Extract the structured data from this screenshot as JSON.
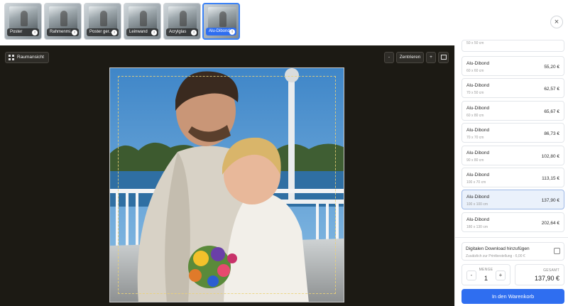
{
  "products": [
    {
      "label": "Poster",
      "active": false
    },
    {
      "label": "Rahmenmi…",
      "active": false
    },
    {
      "label": "Poster ger…",
      "active": false
    },
    {
      "label": "Leinwand",
      "active": false
    },
    {
      "label": "Acrylglas",
      "active": false
    },
    {
      "label": "Alu-Dibond",
      "active": true
    }
  ],
  "product_info_glyph": "i",
  "close_glyph": "×",
  "preview": {
    "room_view_label": "Raumansicht",
    "zoom_minus": "-",
    "zoom_center": "Zentrieren",
    "zoom_plus": "+"
  },
  "options": [
    {
      "name": "",
      "size": "50 x 50 cm",
      "price": "",
      "partial": true
    },
    {
      "name": "Alu-Dibond",
      "size": "60 x 60 cm",
      "price": "55,20 €"
    },
    {
      "name": "Alu-Dibond",
      "size": "70 x 50 cm",
      "price": "62,57 €"
    },
    {
      "name": "Alu-Dibond",
      "size": "60 x 80 cm",
      "price": "65,67 €"
    },
    {
      "name": "Alu-Dibond",
      "size": "70 x 70 cm",
      "price": "86,73 €"
    },
    {
      "name": "Alu-Dibond",
      "size": "90 x 80 cm",
      "price": "102,80 €"
    },
    {
      "name": "Alu-Dibond",
      "size": "100 x 70 cm",
      "price": "113,15 €"
    },
    {
      "name": "Alu-Dibond",
      "size": "100 x 100 cm",
      "price": "137,90 €",
      "selected": true
    },
    {
      "name": "Alu-Dibond",
      "size": "180 x 130 cm",
      "price": "202,64 €"
    }
  ],
  "addon": {
    "title": "Digitalen Download hinzufügen",
    "subtitle": "Zusätzlich zur Printbestellung - 6,00 €"
  },
  "quantity": {
    "label": "MENGE",
    "value": "1",
    "minus": "-",
    "plus": "+"
  },
  "total": {
    "label": "GESAMT",
    "value": "137,90 €"
  },
  "cart_button": "In den Warenkorb",
  "colors": {
    "accent": "#2f6ef0",
    "preview_bg": "#1c1a14",
    "selected_bg": "#eaf1fb"
  }
}
